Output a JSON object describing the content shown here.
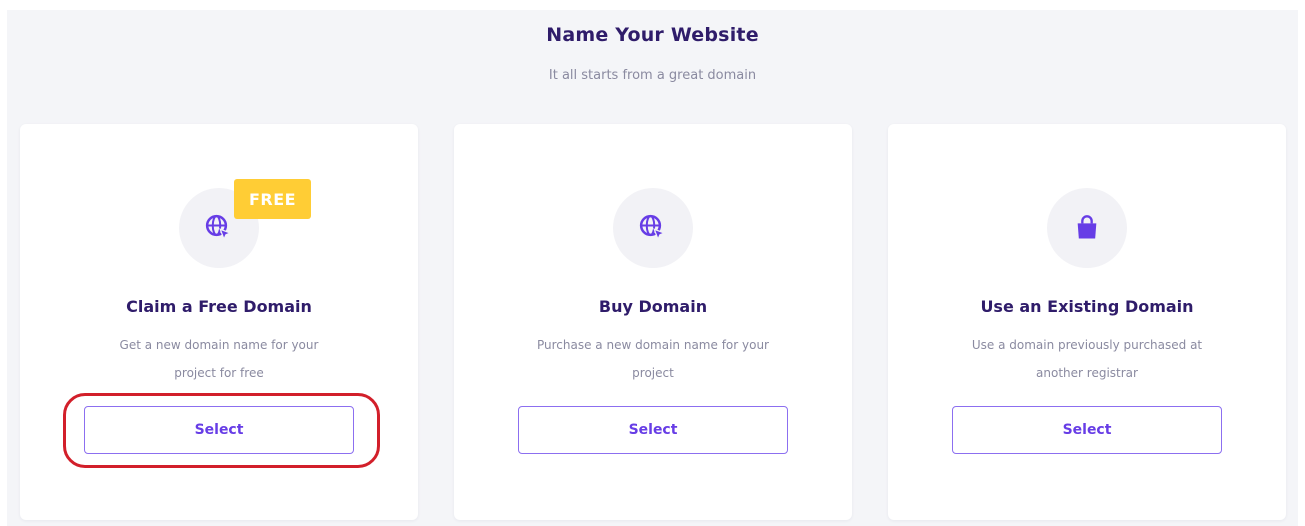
{
  "header": {
    "title": "Name Your Website",
    "subtitle": "It all starts from a great domain"
  },
  "cards": [
    {
      "icon": "globe-cursor-icon",
      "badge": "FREE",
      "title": "Claim a Free Domain",
      "description_line1": "Get a new domain name for your",
      "description_line2": "project for free",
      "button_label": "Select"
    },
    {
      "icon": "globe-cursor-icon",
      "title": "Buy Domain",
      "description_line1": "Purchase a new domain name for your",
      "description_line2": "project",
      "button_label": "Select"
    },
    {
      "icon": "shopping-bag-icon",
      "title": "Use an Existing Domain",
      "description_line1": "Use a domain previously purchased at",
      "description_line2": "another registrar",
      "button_label": "Select"
    }
  ],
  "colors": {
    "accent": "#673de6",
    "title": "#2f1c6a",
    "badge": "#ffcd35",
    "highlight": "#d21f2a",
    "background": "#f4f5f8"
  }
}
